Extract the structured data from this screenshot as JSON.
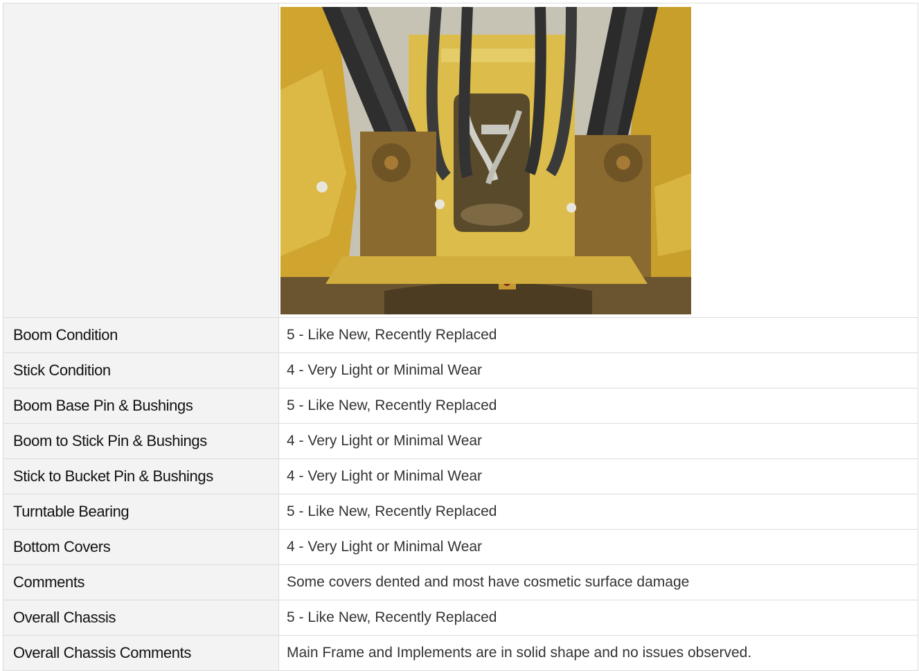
{
  "photo": {
    "subject": "excavator boom base and turntable photo",
    "colors": {
      "machine_yellow": "#d9b43a",
      "dirt": "#6b5530",
      "hose": "#2b2b2b",
      "sky": "#b8b9b5"
    }
  },
  "rows": [
    {
      "label": "Boom Condition",
      "value": "5 - Like New, Recently Replaced"
    },
    {
      "label": "Stick Condition",
      "value": "4 - Very Light or Minimal Wear"
    },
    {
      "label": "Boom Base Pin & Bushings",
      "value": "5 - Like New, Recently Replaced"
    },
    {
      "label": "Boom to Stick Pin & Bushings",
      "value": "4 - Very Light or Minimal Wear"
    },
    {
      "label": "Stick to Bucket Pin & Bushings",
      "value": "4 - Very Light or Minimal Wear"
    },
    {
      "label": "Turntable Bearing",
      "value": "5 - Like New, Recently Replaced"
    },
    {
      "label": "Bottom Covers",
      "value": "4 - Very Light or Minimal Wear"
    },
    {
      "label": "Comments",
      "value": "Some covers dented and most have cosmetic surface damage"
    },
    {
      "label": "Overall Chassis",
      "value": "5 - Like New, Recently Replaced"
    },
    {
      "label": "Overall Chassis Comments",
      "value": "Main Frame and Implements are in solid shape and no issues observed."
    }
  ]
}
